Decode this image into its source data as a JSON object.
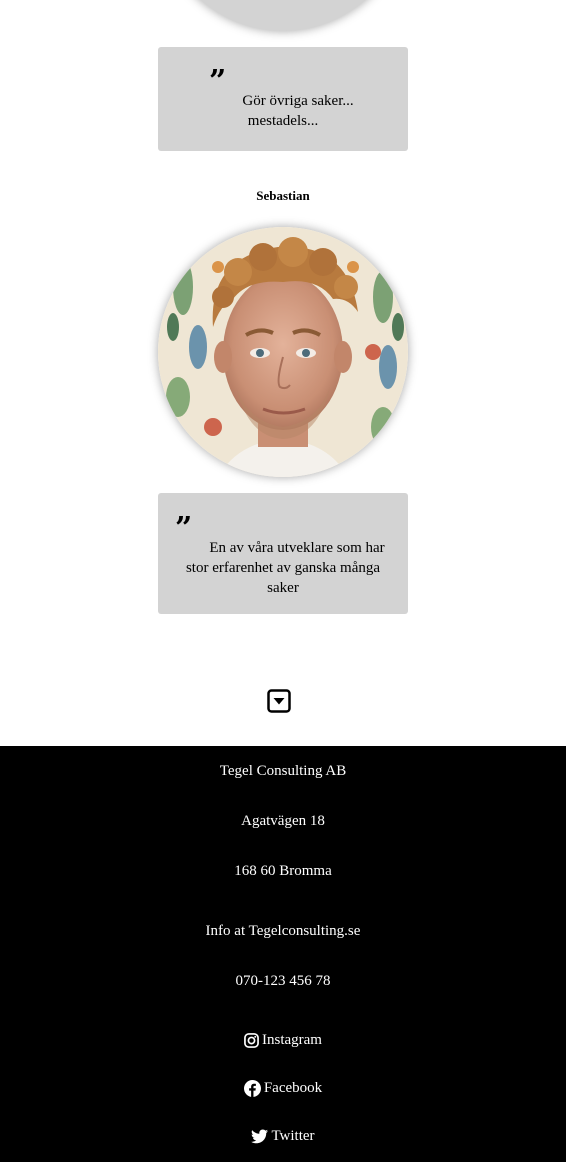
{
  "quotes": [
    {
      "text": "Gör övriga saker... mestadels..."
    },
    {
      "text": "En av våra utveklare som har stor erfarenhet av ganska många saker"
    }
  ],
  "person": {
    "name": "Sebastian"
  },
  "nav": {
    "down_icon": "caret-square-down-icon"
  },
  "footer": {
    "company": "Tegel Consulting AB",
    "street": "Agatvägen 18",
    "city": "168 60 Bromma",
    "email": "Info at Tegelconsulting.se",
    "phone": "070-123 456 78",
    "social": [
      {
        "label": "Instagram",
        "icon": "instagram-icon"
      },
      {
        "label": "Facebook",
        "icon": "facebook-icon"
      },
      {
        "label": "Twitter",
        "icon": "twitter-icon"
      }
    ]
  }
}
